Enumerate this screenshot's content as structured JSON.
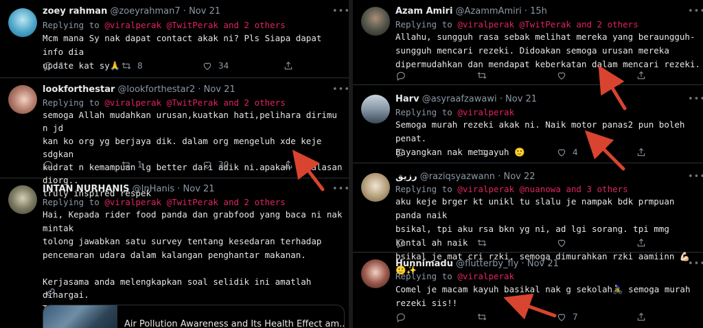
{
  "left": [
    {
      "name": "zoey rahman",
      "handle": "@zoeyrahman7",
      "time": "Nov 21",
      "replying_prefix": "Replying to",
      "mentions": "@viralperak @TwitPerak and 2 others",
      "body": "Mcm mana Sy nak dapat contact akak ni? Pls Siapa dapat info dia\nupdate kat sy🙏",
      "reply_count": "1",
      "retweet_count": "8",
      "like_count": "34"
    },
    {
      "name": "lookforthestar",
      "handle": "@lookforthestar2",
      "time": "Nov 21",
      "replying_prefix": "Replying to",
      "mentions": "@viralperak @TwitPerak and 2 others",
      "body": "semoga Allah mudahkan urusan,kuatkan hati,pelihara dirimu n jd\nkan ko org yg berjaya dik. dalam org mengeluh xde keje sdgkan\nkudrat n kemampuan lg better dari adik ni.apakah lg alasan diorg..\ntruly inspired respek",
      "reply_count": "",
      "retweet_count": "1",
      "like_count": "30"
    },
    {
      "name": "INTAN NURHANIS",
      "handle": "@InHanis",
      "time": "Nov 21",
      "replying_prefix": "Replying to",
      "mentions": "@viralperak @TwitPerak and 2 others",
      "body": "Hai, Kepada rider food panda dan grabfood yang baca ni nak mintak\ntolong jawabkan satu survey tentang kesedaran terhadap\npencemaran udara dalam kalangan penghantar makanan.\n\nKerjasama anda melengkapkan soal selidik ini amatlah dihargai.\nTerima kasih.",
      "card_title": "Air Pollution Awareness and Its Health Effect am..."
    }
  ],
  "right": [
    {
      "name": "Azam Amiri",
      "handle": "@AzammAmiri",
      "time": "15h",
      "replying_prefix": "Replying to",
      "mentions": "@viralperak @TwitPerak and 2 others",
      "body": "Allahu, sungguh rasa sebak melihat mereka yang beraungguh-\nsungguh mencari rezeki. Didoakan semoga urusan mereka\ndipermudahkan dan mendapat keberkatan dalam mencari rezeki."
    },
    {
      "name": "Harv",
      "handle": "@asyraafzawawi",
      "time": "Nov 21",
      "replying_prefix": "Replying to",
      "mentions": "@viralperak",
      "body": "Semoga murah rezeki akak ni. Naik motor panas2 pun boleh penat.\nBayangkan nak mengayuh 🙂",
      "like_count": "4"
    },
    {
      "name": "رزيق",
      "handle": "@raziqsyazwann",
      "time": "Nov 22",
      "replying_prefix": "Replying to",
      "mentions": "@viralperak @nuanowa and 3 others",
      "body": "aku keje brger kt unikl tu slalu je nampak bdk prmpuan panda naik\nbsikal, tpi aku rsa bkn yg ni, ad lgi sorang. tpi mmg kental ah naik\nbsikal je mat cri rzki. semoga dimurahkan rzki aamiinn 💪🏻🙂✨"
    },
    {
      "name": "Hunnimadu",
      "handle": "@flutterby_fly",
      "time": "Nov 21",
      "replying_prefix": "Replying to",
      "mentions": "@viralperak",
      "body": "Comel je macam kayuh basikal nak g sekolah🚴‍♀️ semoga murah\nrezeki sis!!",
      "like_count": "7"
    }
  ],
  "colors": {
    "mention": "#e0245e",
    "arrow": "#d8442f",
    "muted": "#8b98a5"
  },
  "icons": [
    "reply-icon",
    "retweet-icon",
    "like-icon",
    "share-icon",
    "more-icon",
    "link-icon",
    "arrow-annotation"
  ]
}
